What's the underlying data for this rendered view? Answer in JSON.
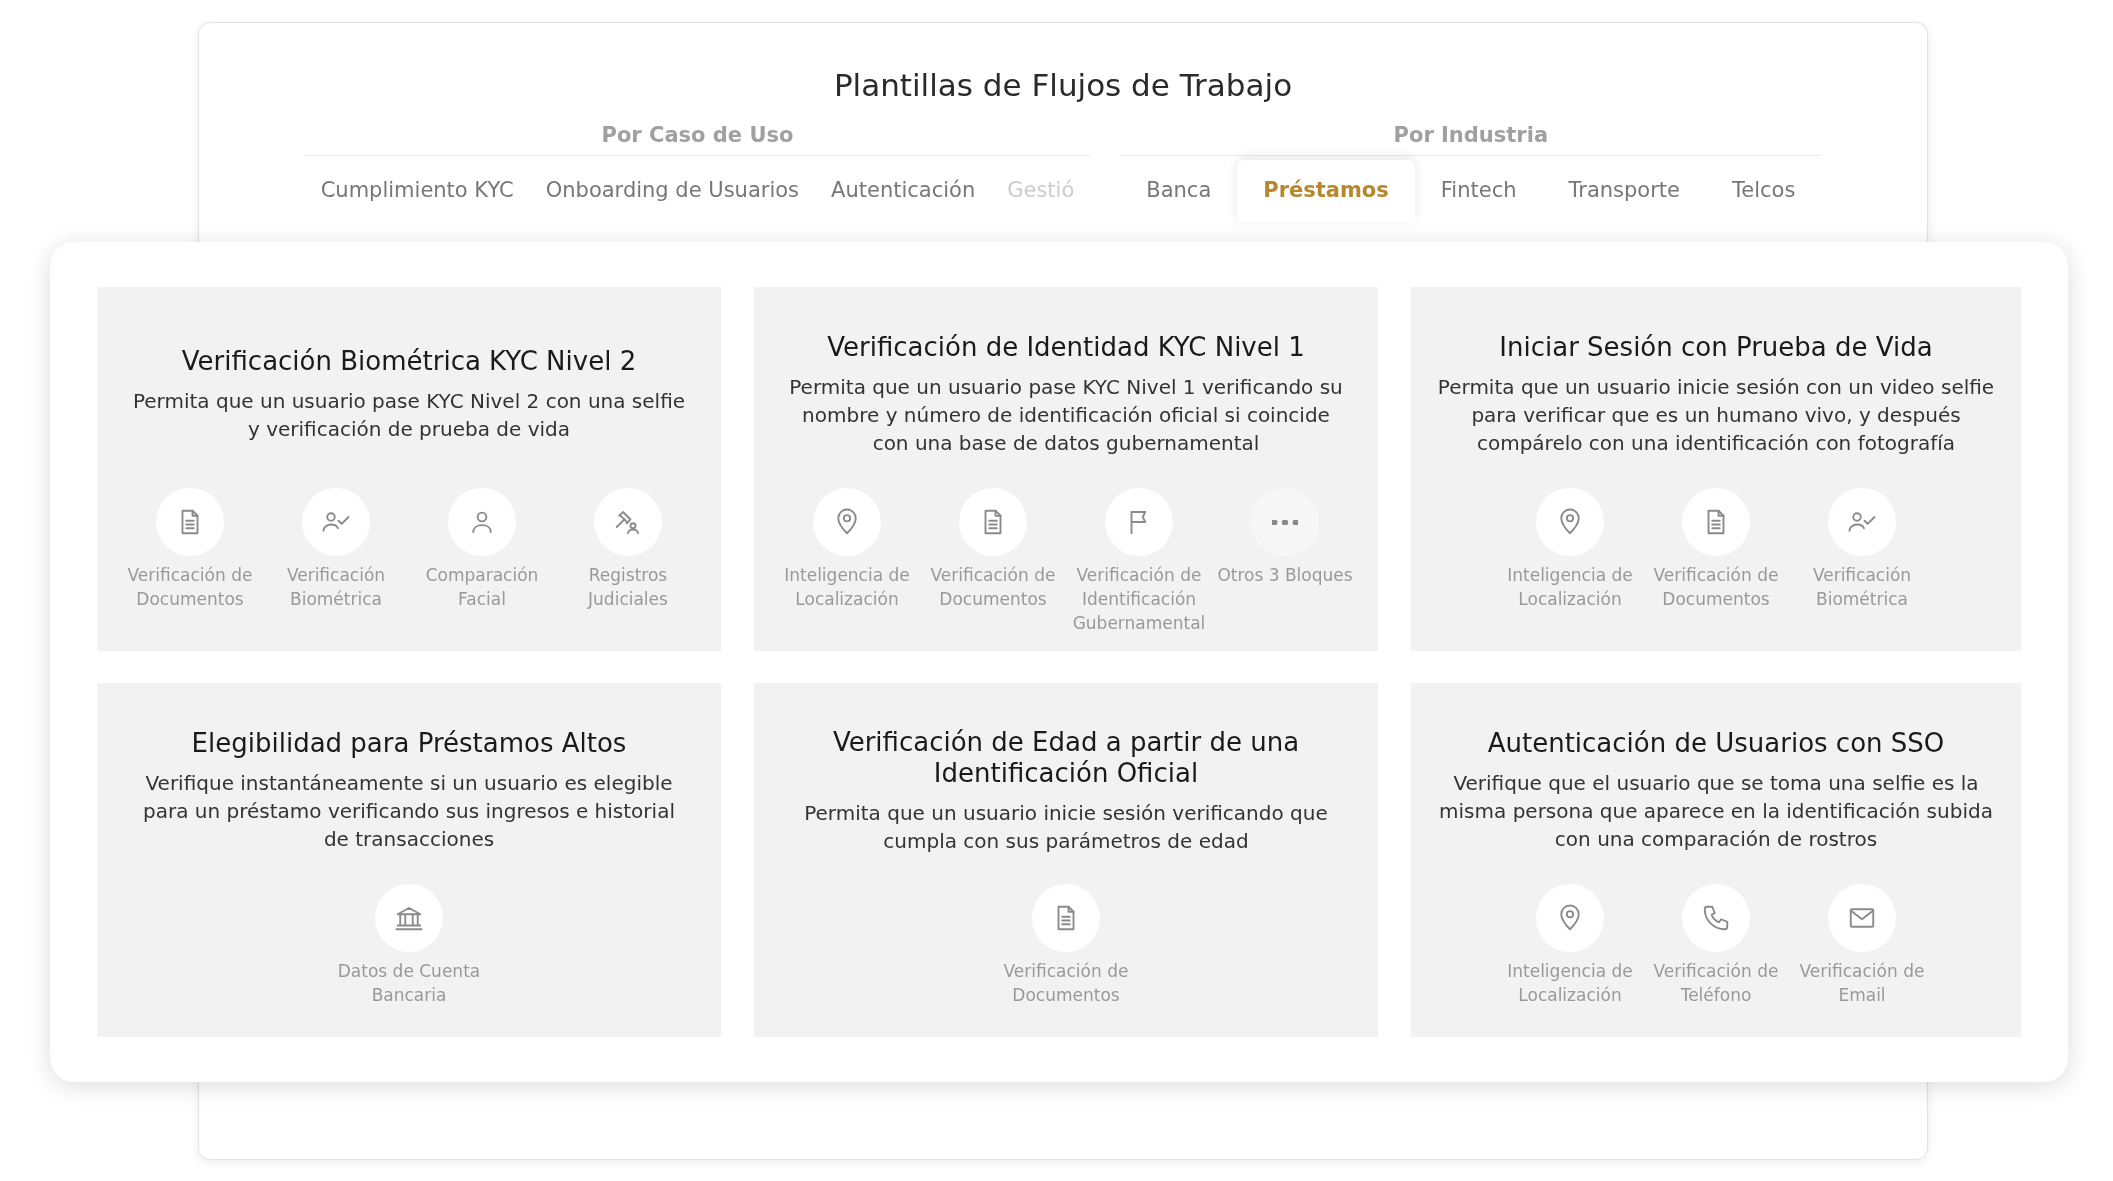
{
  "title": "Plantillas de Flujos de Trabajo",
  "tab_groups": [
    {
      "label": "Por Caso de Uso",
      "tabs": [
        {
          "label": "Cumplimiento KYC",
          "selected": false
        },
        {
          "label": "Onboarding de Usuarios",
          "selected": false
        },
        {
          "label": "Autenticación",
          "selected": false
        },
        {
          "label": "Gestió",
          "selected": false,
          "faded": true
        }
      ]
    },
    {
      "label": "Por Industria",
      "tabs": [
        {
          "label": "Banca",
          "selected": false
        },
        {
          "label": "Préstamos",
          "selected": true
        },
        {
          "label": "Fintech",
          "selected": false
        },
        {
          "label": "Transporte",
          "selected": false
        },
        {
          "label": "Telcos",
          "selected": false
        }
      ]
    }
  ],
  "cards": [
    {
      "title": "Verificación Biométrica KYC Nivel 2",
      "description": "Permita que un usuario pase KYC Nivel 2 con una selfie y verificación de prueba de vida",
      "blocks": [
        {
          "kind": "document",
          "label": "Verificación de Documentos"
        },
        {
          "kind": "biometric",
          "label": "Verificación Biométrica"
        },
        {
          "kind": "face",
          "label": "Comparación Facial"
        },
        {
          "kind": "gavel",
          "label": "Registros Judiciales"
        }
      ]
    },
    {
      "title": "Verificación de Identidad KYC Nivel 1",
      "description": "Permita que un usuario pase KYC Nivel 1 verificando su nombre y número de identificación oficial si coincide con una base de datos gubernamental",
      "blocks": [
        {
          "kind": "location",
          "label": "Inteligencia de Localización"
        },
        {
          "kind": "document",
          "label": "Verificación de Documentos"
        },
        {
          "kind": "flag",
          "label": "Verificación de Identificación Gubernamental"
        },
        {
          "kind": "more",
          "label": "Otros 3 Bloques"
        }
      ]
    },
    {
      "title": "Iniciar Sesión con Prueba de Vida",
      "description": "Permita que un usuario inicie sesión con un video selfie para verificar que es un humano vivo, y después compárelo con una identificación con fotografía",
      "blocks": [
        {
          "kind": "location",
          "label": "Inteligencia de Localización"
        },
        {
          "kind": "document",
          "label": "Verificación de Documentos"
        },
        {
          "kind": "biometric",
          "label": "Verificación Biométrica"
        }
      ]
    },
    {
      "title": "Elegibilidad para Préstamos Altos",
      "description": "Verifique instantáneamente si un usuario es elegible para un préstamo verificando sus ingresos e historial de transacciones",
      "blocks": [
        {
          "kind": "bank",
          "label": "Datos de Cuenta Bancaria"
        }
      ]
    },
    {
      "title": "Verificación de Edad a partir de una Identificación Oficial",
      "description": "Permita que un usuario inicie sesión verificando que cumpla con sus parámetros de edad",
      "blocks": [
        {
          "kind": "document",
          "label": "Verificación de Documentos"
        }
      ]
    },
    {
      "title": "Autenticación de Usuarios con SSO",
      "description": "Verifique que el usuario que se toma una selfie es la misma persona que aparece en la identificación subida con una comparación de rostros",
      "blocks": [
        {
          "kind": "location",
          "label": "Inteligencia de Localización"
        },
        {
          "kind": "phone",
          "label": "Verificación de Teléfono"
        },
        {
          "kind": "email",
          "label": "Verificación de Email"
        }
      ]
    }
  ]
}
